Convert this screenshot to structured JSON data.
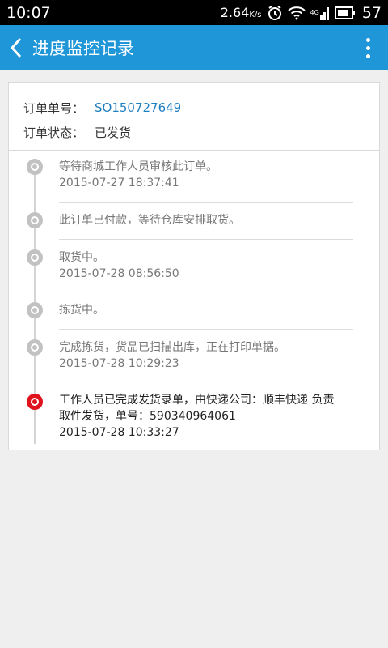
{
  "status_bar": {
    "time": "10:07",
    "speed": "2.64",
    "speed_unit": "K/s",
    "network": "4G",
    "battery": "57"
  },
  "app_bar": {
    "title": "进度监控记录"
  },
  "order": {
    "number_label": "订单单号：",
    "number": "SO150727649",
    "status_label": "订单状态：",
    "status": "已发货"
  },
  "timeline": [
    {
      "text": "等待商城工作人员审核此订单。",
      "time": "2015-07-27 18:37:41"
    },
    {
      "text": "此订单已付款，等待仓库安排取货。",
      "time": ""
    },
    {
      "text": "取货中。",
      "time": "2015-07-28 08:56:50"
    },
    {
      "text": "拣货中。",
      "time": ""
    },
    {
      "text": "完成拣货，货品已扫描出库，正在打印单据。",
      "time": "2015-07-28 10:29:23"
    },
    {
      "text": "工作人员已完成发货录单，由快递公司：顺丰快递 负责",
      "text2": "取件发货，单号：590340964061",
      "time": "2015-07-28 10:33:27"
    }
  ],
  "colors": {
    "primary": "#1e96d7",
    "current_node": "#e0121d",
    "node": "#c2c2c2",
    "link": "#1e7fc0"
  }
}
